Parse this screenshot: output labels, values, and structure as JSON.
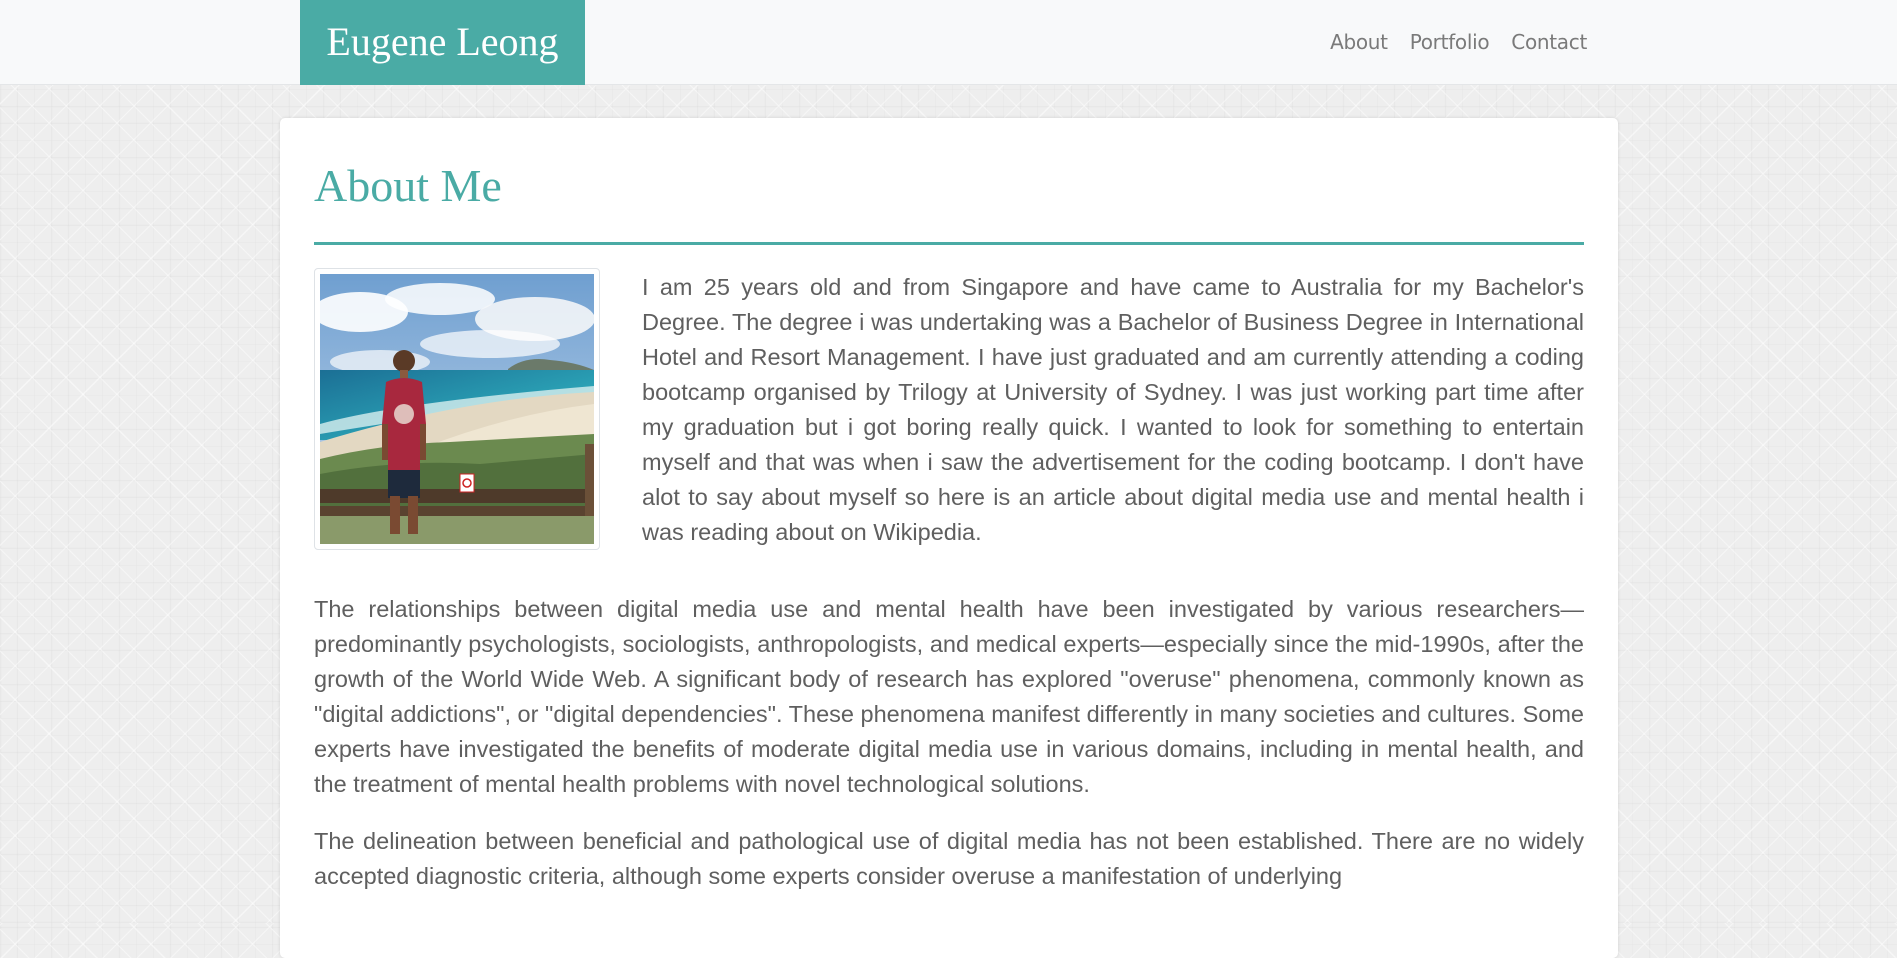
{
  "nav": {
    "brand": "Eugene Leong",
    "links": [
      "About",
      "Portfolio",
      "Contact"
    ]
  },
  "about": {
    "title": "About Me",
    "intro": "I am 25 years old and from Singapore and have came to Australia for my Bachelor's Degree. The degree i was undertaking was a Bachelor of Business Degree in International Hotel and Resort Management. I have just graduated and am currently attending a coding bootcamp organised by Trilogy at University of Sydney. I was just working part time after my graduation but i got boring really quick. I wanted to look for something to entertain myself and that was when i saw the advertisement for the coding bootcamp. I don't have alot to say about myself so here is an article about digital media use and mental health i was reading about on Wikipedia.",
    "paragraphs": [
      "The relationships between digital media use and mental health have been investigated by various researchers—predominantly psychologists, sociologists, anthropologists, and medical experts—especially since the mid-1990s, after the growth of the World Wide Web. A significant body of research has explored \"overuse\" phenomena, commonly known as \"digital addictions\", or \"digital dependencies\". These phenomena manifest differently in many societies and cultures. Some experts have investigated the benefits of moderate digital media use in various domains, including in mental health, and the treatment of mental health problems with novel technological solutions.",
      "The delineation between beneficial and pathological use of digital media has not been established. There are no widely accepted diagnostic criteria, although some experts consider overuse a manifestation of underlying"
    ]
  },
  "colors": {
    "accent": "#4aaba5",
    "navbar_bg": "#f8f9fa",
    "text": "#5f5f5f"
  }
}
